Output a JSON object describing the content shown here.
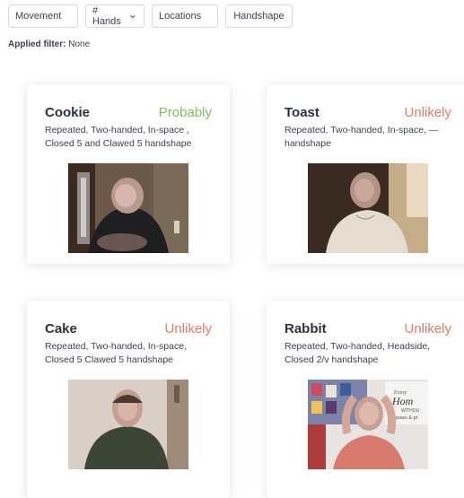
{
  "filters": {
    "movement": "Movement",
    "hands": "# Hands",
    "locations": "Locations",
    "handshape": "Handshape"
  },
  "applied": {
    "label": "Applied filter:",
    "value": " None"
  },
  "cards": [
    {
      "title": "Cookie",
      "status": "Probably",
      "description": "Repeated, Two-handed, In-space , Closed 5 and Clawed 5 handshape"
    },
    {
      "title": "Toast",
      "status": "Unlikely",
      "description": "Repeated, Two-handed, In-space, — handshape"
    },
    {
      "title": "Cake",
      "status": "Unlikely",
      "description": "Repeated, Two-handed, In-space, Closed 5 Clawed 5 handshape"
    },
    {
      "title": "Rabbit",
      "status": "Unlikely",
      "description": "Repeated, Two-handed, Headside, Closed 2/v handshape"
    }
  ],
  "photo_text": {
    "line1": "Hom",
    "line2": "WITHOU",
    "line3": "paws & pr",
    "line4": "Every"
  },
  "colors": {
    "probably": "#7cc25a",
    "unlikely": "#e27b66",
    "text": "#2c3440"
  }
}
